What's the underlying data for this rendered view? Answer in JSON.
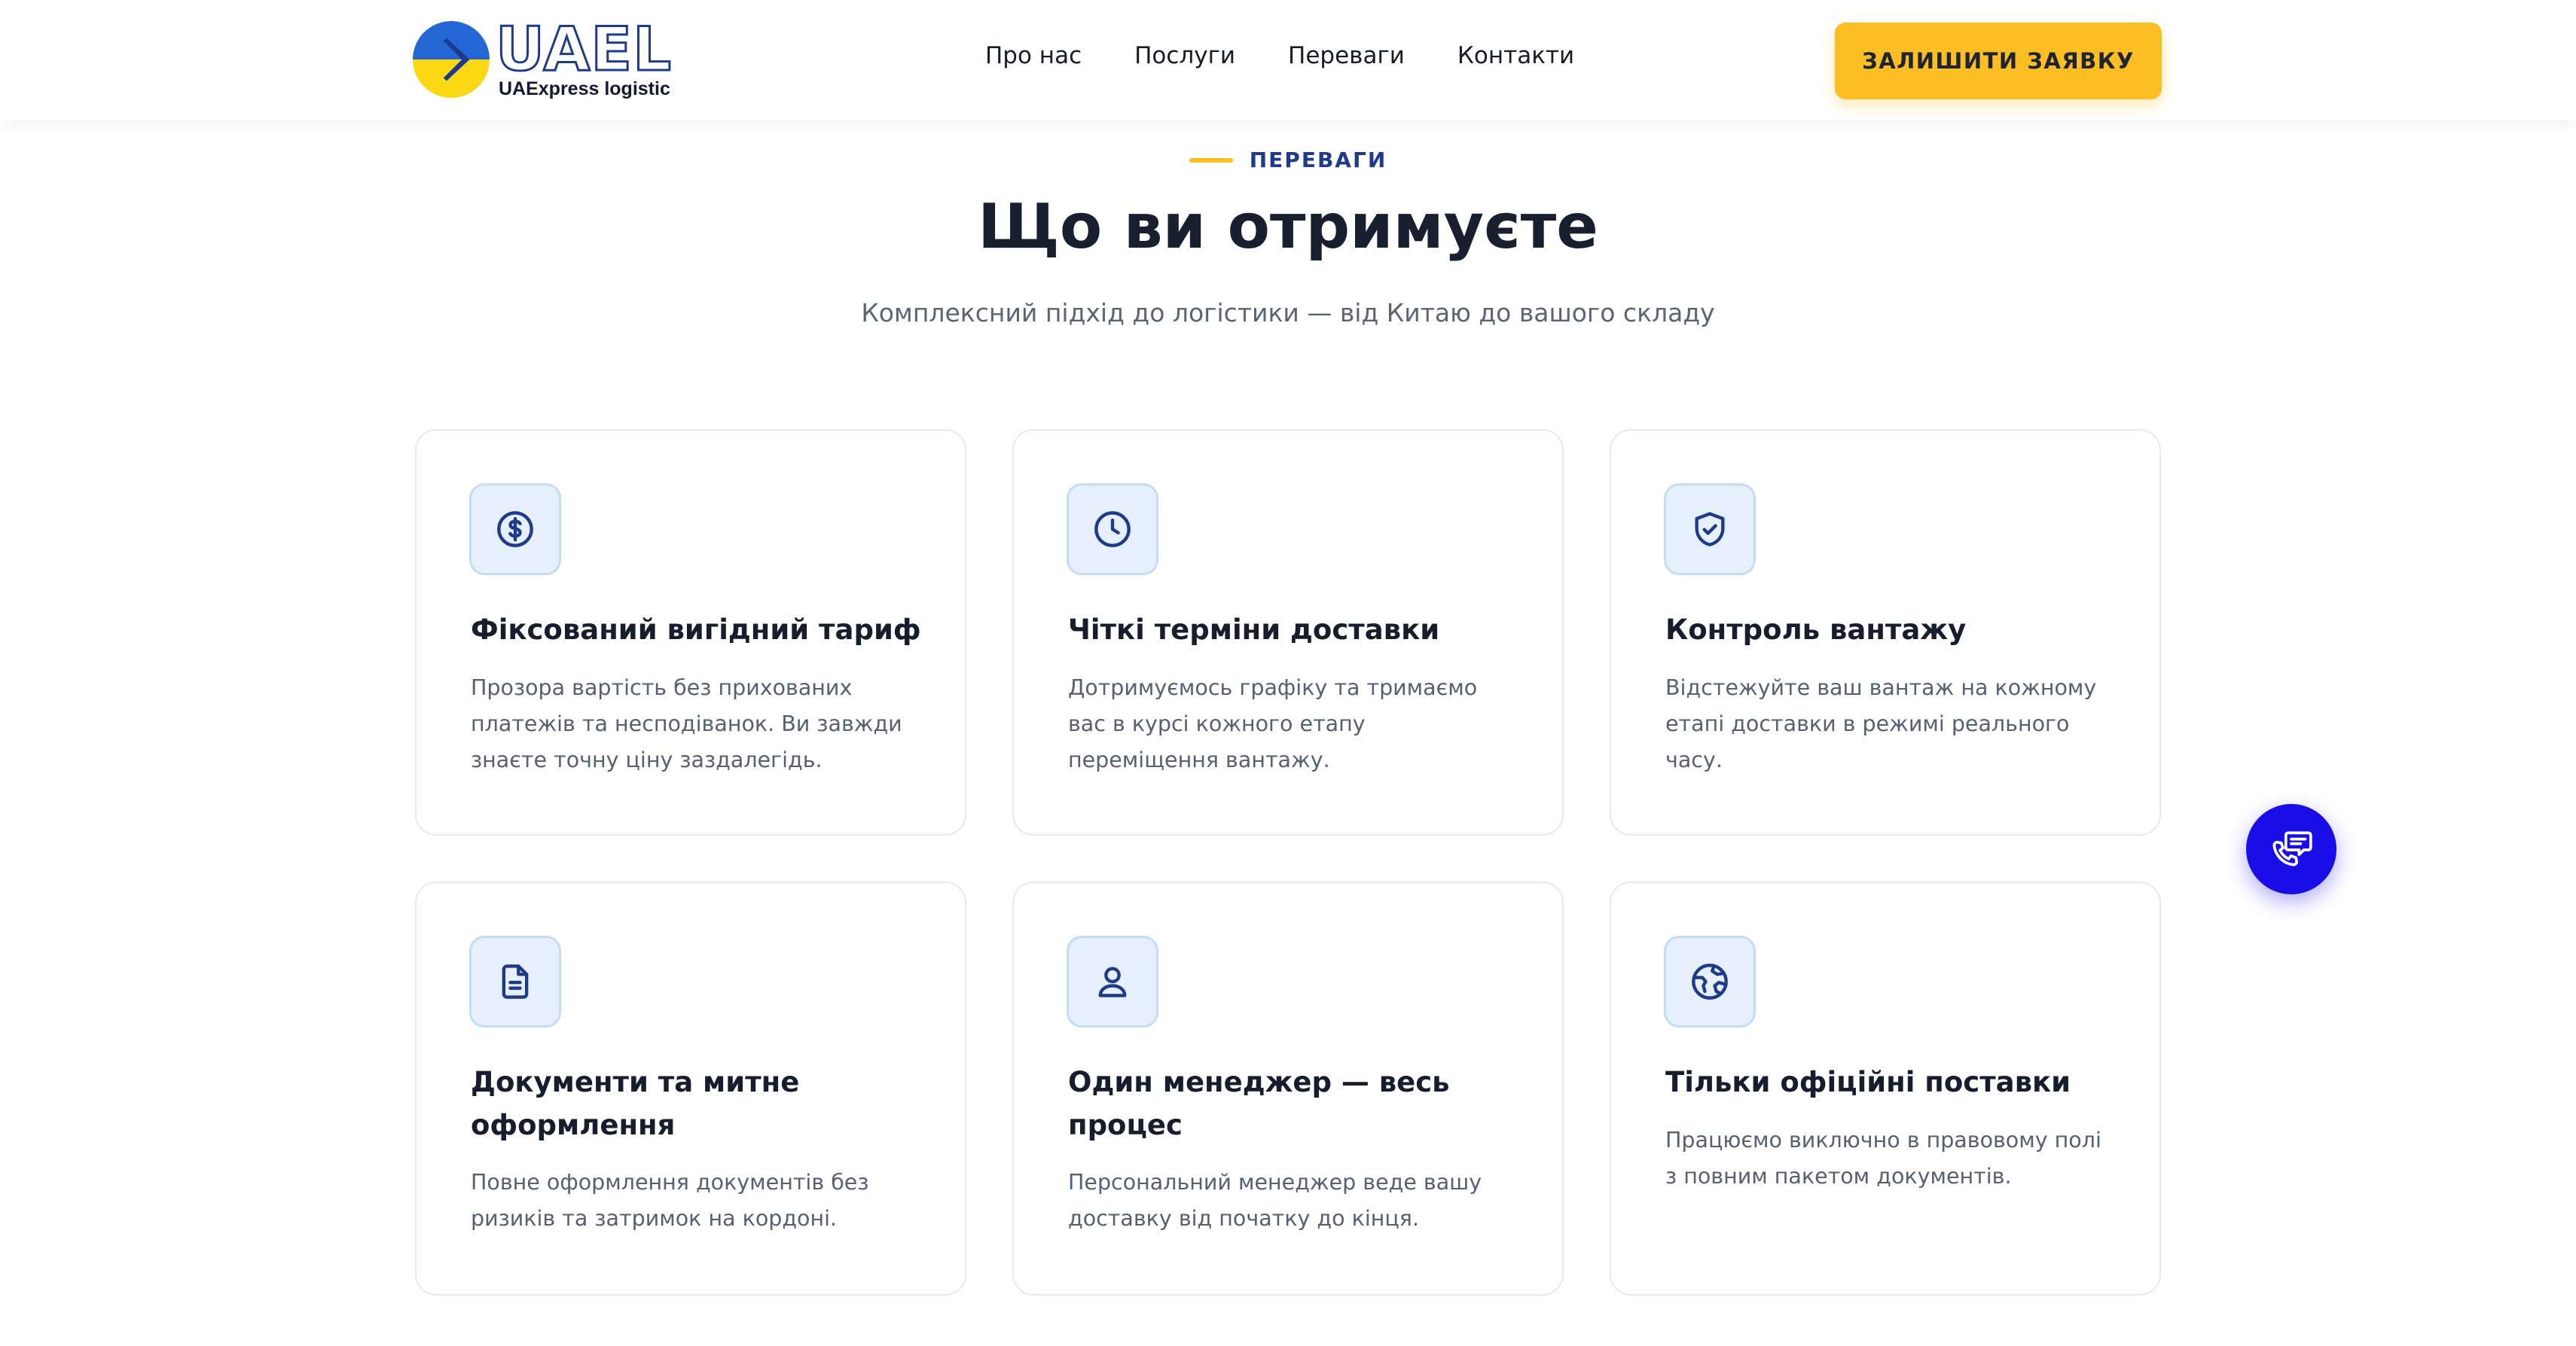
{
  "brand": {
    "name": "UAEL",
    "tagline": "UAExpress logistic",
    "colors": {
      "blue": "#1b3b8c",
      "flag_blue": "#2466d4",
      "flag_yellow": "#fbd714"
    }
  },
  "nav": {
    "items": [
      {
        "label": "Про нас"
      },
      {
        "label": "Послуги"
      },
      {
        "label": "Переваги"
      },
      {
        "label": "Контакти"
      }
    ]
  },
  "header": {
    "cta_label": "ЗАЛИШИТИ ЗАЯВКУ",
    "cta_color": "#fbbf24"
  },
  "section": {
    "eyebrow": "ПЕРЕВАГИ",
    "title": "Що ви отримуєте",
    "subtitle": "Комплексний підхід до логістики — від Китаю до вашого складу"
  },
  "cards": [
    {
      "icon": "dollar-coin-icon",
      "title": "Фіксований вигідний тариф",
      "text": "Прозора вартість без прихованих платежів та несподіванок. Ви завжди знаєте точну ціну заздалегідь."
    },
    {
      "icon": "clock-icon",
      "title": "Чіткі терміни доставки",
      "text": "Дотримуємось графіку та тримаємо вас в курсі кожного етапу переміщення вантажу."
    },
    {
      "icon": "shield-check-icon",
      "title": "Контроль вантажу",
      "text": "Відстежуйте ваш вантаж на кожному етапі доставки в режимі реального часу."
    },
    {
      "icon": "document-icon",
      "title": "Документи та митне оформлення",
      "text": "Повне оформлення документів без ризиків та затримок на кордоні."
    },
    {
      "icon": "user-icon",
      "title": "Один менеджер — весь процес",
      "text": "Персональний менеджер веде вашу доставку від початку до кінця."
    },
    {
      "icon": "globe-icon",
      "title": "Тільки офіційні поставки",
      "text": "Працюємо виключно в правовому полі з повним пакетом документів."
    }
  ],
  "chat": {
    "icon": "phone-chat-icon",
    "color": "#1a0ee8"
  }
}
